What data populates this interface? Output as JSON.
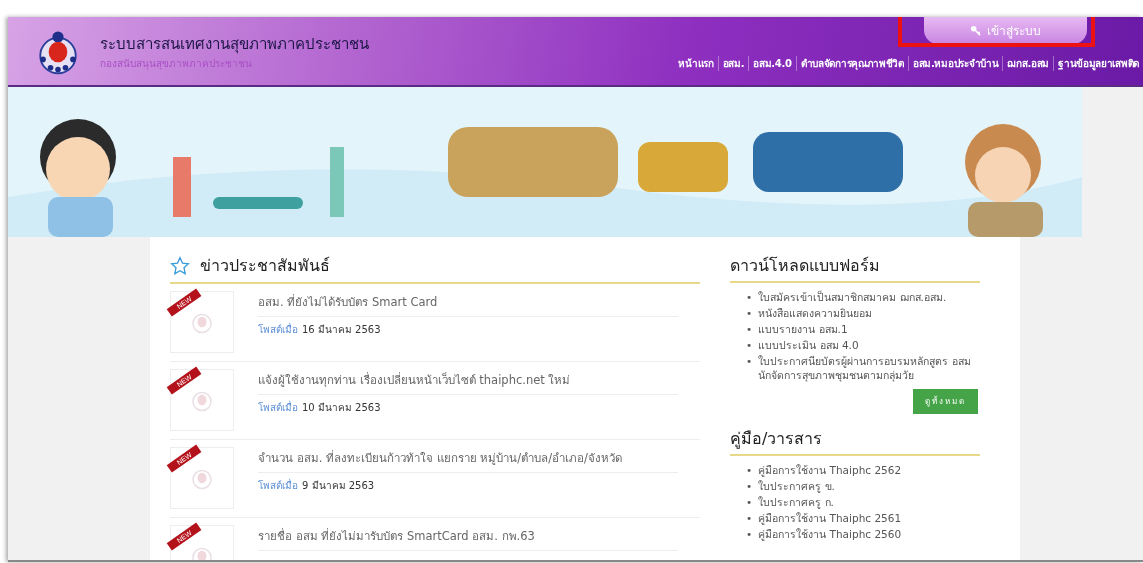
{
  "header": {
    "title": "ระบบสารสนเทศงานสุขภาพภาคประชาชน",
    "subtitle": "กองสนับสนุนสุขภาพภาคประชาชน",
    "login": {
      "label": "เข้าสู่ระบบ",
      "highlighted": true
    },
    "nav": [
      "หน้าแรก",
      "อสม.",
      "อสม.4.0",
      "ตำบลจัดการคุณภาพชีวิต",
      "อสม.หมอประจำบ้าน",
      "ฌกส.อสม",
      "ฐานข้อมูลยาเสพติด"
    ]
  },
  "news": {
    "title": "ข่าวประชาสัมพันธ์",
    "items": [
      {
        "badge": "NEW",
        "title": "อสม. ที่ยังไม่ได้รับบัตร Smart Card",
        "posted_label": "โพสต์เมื่อ",
        "date": "16 มีนาคม 2563"
      },
      {
        "badge": "NEW",
        "title": "แจ้งผู้ใช้งานทุกท่าน เรื่องเปลี่ยนหน้าเว็บไซต์ thaiphc.net ใหม่",
        "posted_label": "โพสต์เมื่อ",
        "date": "10 มีนาคม 2563"
      },
      {
        "badge": "NEW",
        "title": "จำนวน อสม. ที่ลงทะเบียนก้าวท้าใจ แยกราย หมู่บ้าน/ตำบล/อำเภอ/จังหวัด",
        "posted_label": "โพสต์เมื่อ",
        "date": "9 มีนาคม 2563"
      },
      {
        "badge": "NEW",
        "title": "รายชื่อ อสม ที่ยังไม่มารับบัตร SmartCard อสม. กพ.63"
      }
    ]
  },
  "downloads": {
    "title": "ดาวน์โหลดแบบฟอร์ม",
    "marker": "•",
    "items": [
      "ใบสมัครเข้าเป็นสมาชิกสมาคม ฌกส.อสม.",
      "หนังสือแสดงความยินยอม",
      "แบบรายงาน อสม.1",
      "แบบประเมิน อสม 4.0",
      "ใบประกาศนียบัตรผู้ผ่านการอบรมหลักสูตร อสม นักจัดการสุขภาพชุมชนตามกลุ่มวัย"
    ],
    "button": "ดูทั้งหมด"
  },
  "manuals": {
    "title": "คู่มือ/วารสาร",
    "marker": "•",
    "items": [
      "คู่มือการใช้งาน Thaiphc 2562",
      "ใบประกาศครู ข.",
      "ใบประกาศครู ก.",
      "คู่มือการใช้งาน Thaiphc 2561",
      "คู่มือการใช้งาน Thaiphc 2560"
    ]
  }
}
